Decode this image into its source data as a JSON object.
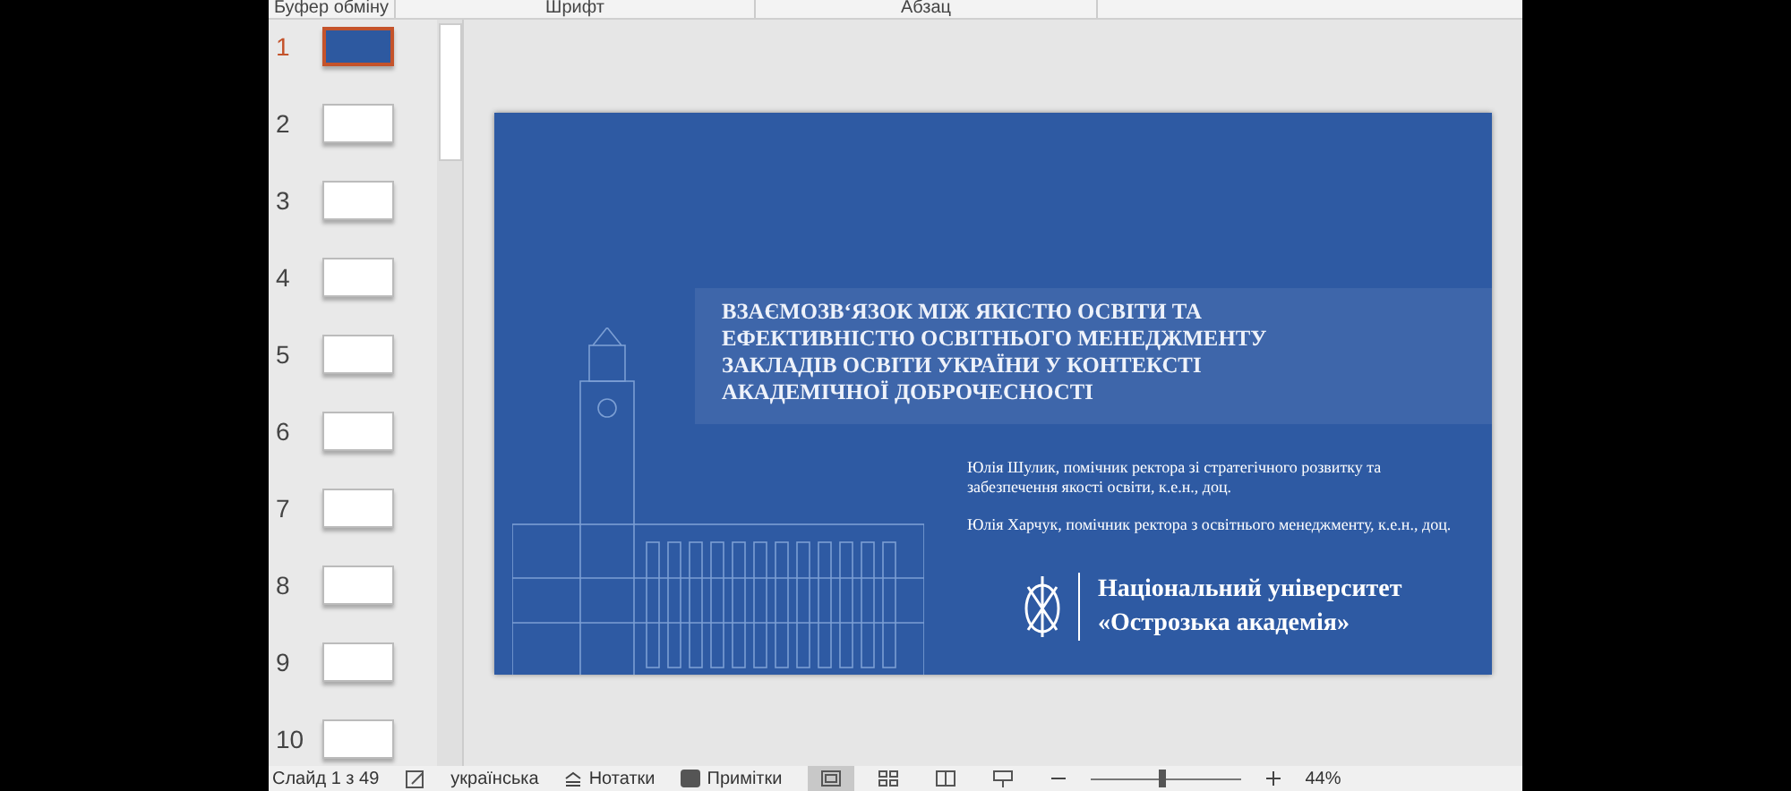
{
  "ribbon_groups": [
    "Буфер обміну",
    "Шрифт",
    "Абзац"
  ],
  "thumbnails": [
    {
      "number": "1",
      "selected": true,
      "kind": "title"
    },
    {
      "number": "2",
      "selected": false,
      "kind": "content"
    },
    {
      "number": "3",
      "selected": false,
      "kind": "content"
    },
    {
      "number": "4",
      "selected": false,
      "kind": "content"
    },
    {
      "number": "5",
      "selected": false,
      "kind": "content"
    },
    {
      "number": "6",
      "selected": false,
      "kind": "content"
    },
    {
      "number": "7",
      "selected": false,
      "kind": "content"
    },
    {
      "number": "8",
      "selected": false,
      "kind": "content"
    },
    {
      "number": "9",
      "selected": false,
      "kind": "content"
    },
    {
      "number": "10",
      "selected": false,
      "kind": "content"
    }
  ],
  "slide": {
    "title": "ВЗАЄМОЗВ‘ЯЗОК МІЖ ЯКІСТЮ ОСВІТИ ТА ЕФЕКТИВНІСТЮ ОСВІТНЬОГО МЕНЕДЖМЕНТУ ЗАКЛАДІВ ОСВІТИ УКРАЇНИ У КОНТЕКСТІ АКАДЕМІЧНОЇ ДОБРОЧЕСНОСТІ",
    "authors": [
      "Юлія Шулик, помічник ректора зі стратегічного розвитку та забезпечення якості освіти, к.е.н., доц.",
      "Юлія Харчук, помічник ректора з освітнього менеджменту, к.е.н., доц."
    ],
    "university": [
      "Національний університет",
      "«Острозька академія»"
    ]
  },
  "status_bar": {
    "slide_counter": "Слайд 1 з 49",
    "language": "українська",
    "notes": "Нотатки",
    "comments": "Примітки",
    "views": [
      {
        "kind": "normal",
        "selected": true
      },
      {
        "kind": "sorter",
        "selected": false
      },
      {
        "kind": "reading",
        "selected": false
      },
      {
        "kind": "show",
        "selected": false
      }
    ],
    "zoom": {
      "level": 0.45,
      "reading": "44%"
    }
  }
}
